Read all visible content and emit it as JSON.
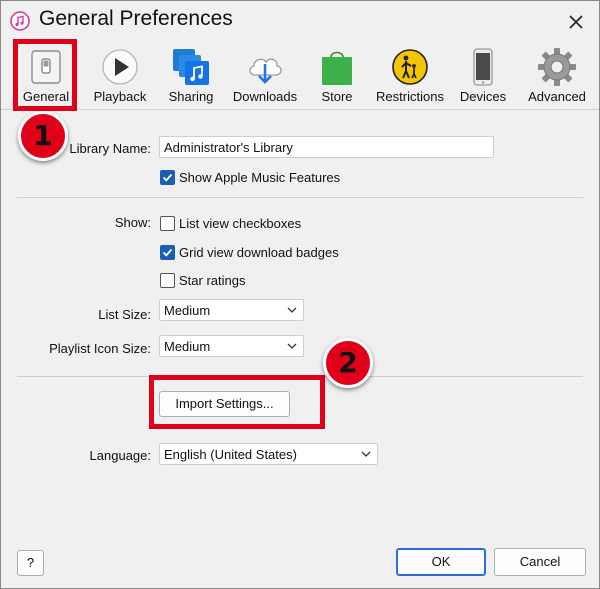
{
  "window": {
    "title": "General Preferences"
  },
  "toolbar": {
    "items": [
      {
        "label": "General",
        "icon": "general-switch-icon"
      },
      {
        "label": "Playback",
        "icon": "play-icon"
      },
      {
        "label": "Sharing",
        "icon": "sharing-music-icon"
      },
      {
        "label": "Downloads",
        "icon": "cloud-download-icon"
      },
      {
        "label": "Store",
        "icon": "store-bag-icon"
      },
      {
        "label": "Restrictions",
        "icon": "parental-restrictions-icon"
      },
      {
        "label": "Devices",
        "icon": "device-phone-icon"
      },
      {
        "label": "Advanced",
        "icon": "gear-icon"
      }
    ],
    "selected": "General"
  },
  "general": {
    "library_name_label": "Library Name:",
    "library_name_value": "Administrator's Library",
    "show_apple_music": {
      "label": "Show Apple Music Features",
      "checked": true
    },
    "show_label": "Show:",
    "list_view_checkboxes": {
      "label": "List view checkboxes",
      "checked": false
    },
    "grid_view_badges": {
      "label": "Grid view download badges",
      "checked": true
    },
    "star_ratings": {
      "label": "Star ratings",
      "checked": false
    },
    "list_size_label": "List Size:",
    "list_size_value": "Medium",
    "playlist_icon_size_label": "Playlist Icon Size:",
    "playlist_icon_size_value": "Medium",
    "import_settings_label": "Import Settings...",
    "language_label": "Language:",
    "language_value": "English (United States)"
  },
  "footer": {
    "help_label": "?",
    "ok_label": "OK",
    "cancel_label": "Cancel"
  },
  "annotations": {
    "step1": "1",
    "step2": "2",
    "highlight_color": "#e0001a"
  },
  "colors": {
    "accent": "#1a5fb4",
    "store_green": "#3cb04a",
    "restrictions_yellow": "#f2c500"
  }
}
